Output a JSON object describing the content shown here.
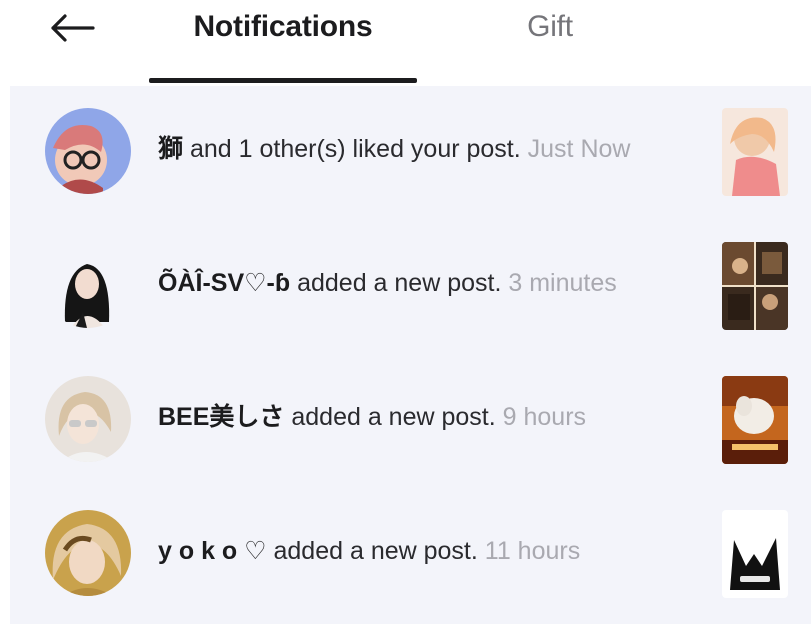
{
  "header": {
    "back_icon": "arrow-left-icon",
    "tabs": [
      {
        "label": "Notifications",
        "active": true
      },
      {
        "label": "Gift",
        "active": false
      }
    ]
  },
  "notifications": [
    {
      "user": "獅",
      "action": "and 1 other(s) liked your post.",
      "time": "Just Now"
    },
    {
      "user": "ÕÀÎ-SV♡-ɓ",
      "action": "added a new post.",
      "time": "3 minutes"
    },
    {
      "user": "BEE美しさ",
      "action": "added a new post.",
      "time": "9 hours"
    },
    {
      "user": "y o k o ♡",
      "action": "added a new post.",
      "time": "11 hours"
    }
  ],
  "colors": {
    "active_tab": "#1c1c1e",
    "inactive_tab": "#75757a",
    "list_background": "#f3f4fa",
    "timestamp": "#a9a9b0"
  }
}
